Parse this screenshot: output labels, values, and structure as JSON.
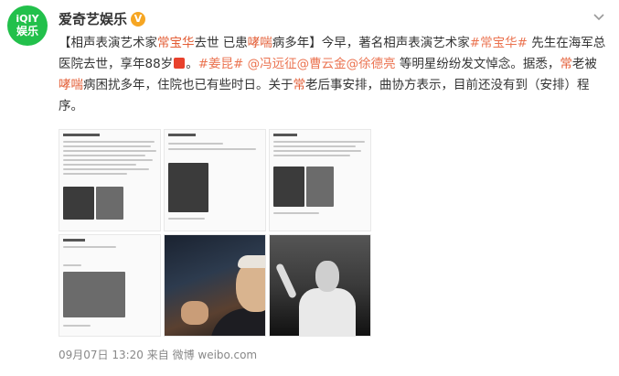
{
  "account": {
    "avatar_line1": "iQIY",
    "avatar_line2": "娱乐",
    "name": "爱奇艺娱乐",
    "verified_badge": "V",
    "menu_icon": "chevron-down-icon"
  },
  "post": {
    "t1": "【相声表演艺术家",
    "t2": "常宝华",
    "t3": "去世 已患",
    "t4": "哮喘",
    "t5": "病多年】今早，著名相声表演艺术家",
    "t6": "#常宝华#",
    "t7": " 先生在海军总医院去世，享年88岁",
    "t8": "。",
    "t9": "#姜昆#",
    "t10": " @冯远征",
    "t11": "@曹云金",
    "t12": "@徐德亮",
    "t13": " 等明星纷纷发文悼念。据悉，",
    "t14": "常",
    "t15": "老被",
    "t16": "哮喘",
    "t17": "病困扰多年，住院也已有些时日。关于",
    "t18": "常",
    "t19": "老后事安排，曲协方表示，目前还没有到（安排）程序。"
  },
  "footer": {
    "date": "09月07日 13:20",
    "source": " 来自 微博 weibo.com"
  },
  "colors": {
    "highlight": "#e35d35",
    "link": "#eb7350",
    "brand": "#22c04b",
    "verified": "#f6a623"
  }
}
